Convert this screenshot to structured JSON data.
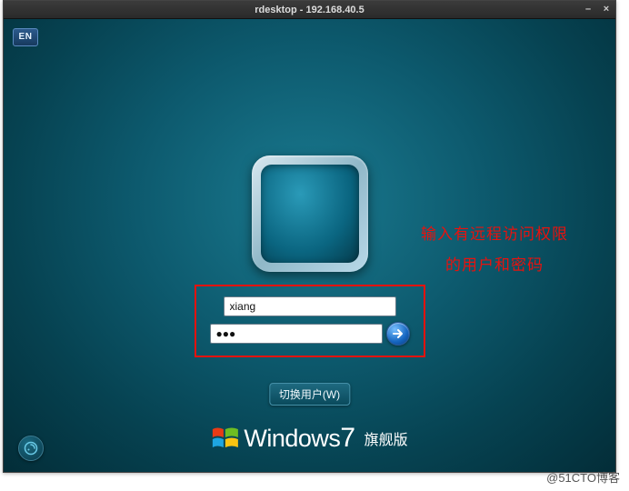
{
  "window": {
    "title": "rdesktop - 192.168.40.5"
  },
  "ime": {
    "label": "EN"
  },
  "login": {
    "username_value": "xiang",
    "password_value": "●●●"
  },
  "buttons": {
    "switch_user": "切换用户(W)"
  },
  "annotation": {
    "text": "输入有远程访问权限的用户和密码"
  },
  "branding": {
    "product": "Windows",
    "version": "7",
    "edition": "旗舰版"
  },
  "watermark": "@51CTO博客"
}
